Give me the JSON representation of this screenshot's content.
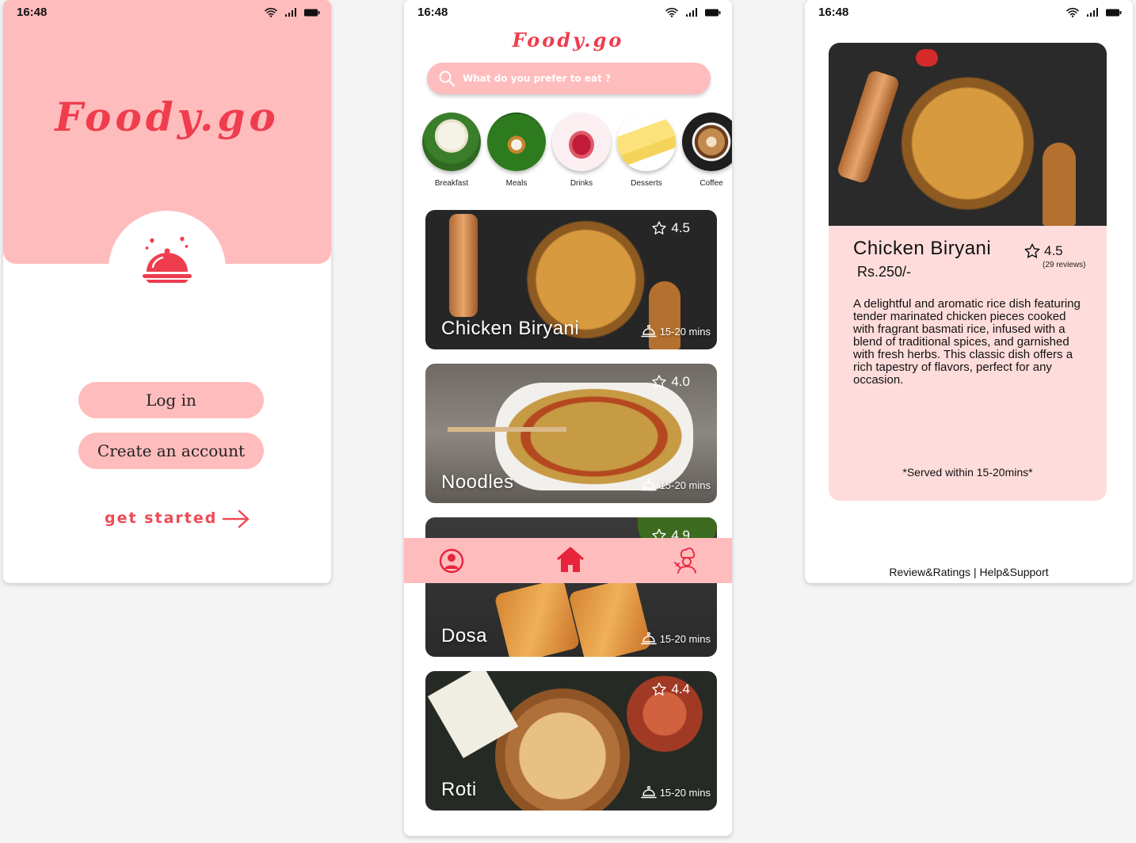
{
  "status_time": "16:48",
  "brand": "Foody.go",
  "welcome": {
    "login_label": "Log in",
    "create_label": "Create an account",
    "get_started_label": "get started"
  },
  "home": {
    "search_placeholder": "What do you prefer to eat ?",
    "categories": [
      "Breakfast",
      "Meals",
      "Drinks",
      "Desserts",
      "Coffee"
    ],
    "dishes": [
      {
        "name": "Chicken Biryani",
        "rating": "4.5",
        "time": "15-20 mins"
      },
      {
        "name": "Noodles",
        "rating": "4.0",
        "time": "15-20 mins"
      },
      {
        "name": "Dosa",
        "rating": "4.9",
        "time": "15-20 mins"
      },
      {
        "name": "Roti",
        "rating": "4.4",
        "time": "15-20 mins"
      }
    ]
  },
  "detail": {
    "title": "Chicken Biryani",
    "price": "Rs.250/-",
    "rating": "4.5",
    "reviews": "(29 reviews)",
    "description": "A delightful and aromatic rice dish featuring tender marinated chicken pieces cooked with fragrant basmati rice, infused with a blend of traditional spices, and garnished with fresh herbs. This classic dish offers a rich tapestry of flavors, perfect for any occasion.",
    "served": "*Served within 15-20mins*",
    "footer": "Review&Ratings | Help&Support"
  },
  "colors": {
    "pink": "#ffbcbc",
    "light_pink": "#ffdcdc",
    "accent_red": "#ef3d4e",
    "icon_red": "#e8233c"
  },
  "icons": [
    "wifi-icon",
    "signal-icon",
    "battery-icon",
    "cloche-icon",
    "arrow-right-icon",
    "search-icon",
    "star-icon",
    "cloche-small-icon",
    "profile-icon",
    "home-icon",
    "chef-icon"
  ]
}
